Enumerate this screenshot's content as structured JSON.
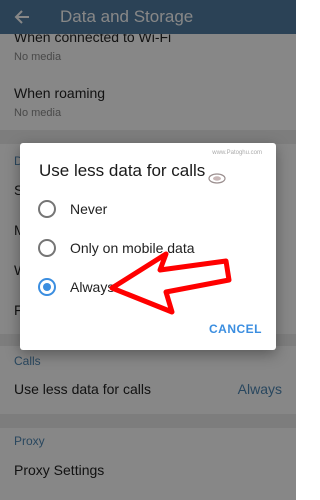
{
  "appbar": {
    "title": "Data and Storage",
    "back_icon": "arrow-left-icon"
  },
  "list": {
    "wifi": {
      "label": "When connected to Wi-Fi",
      "value": "No media"
    },
    "roaming": {
      "label": "When roaming",
      "value": "No media"
    },
    "section_d": "D",
    "truncated": [
      "S",
      "M",
      "W",
      "F"
    ],
    "calls_section": "Calls",
    "calls_row": {
      "label": "Use less data for calls",
      "value": "Always"
    },
    "proxy_section": "Proxy",
    "proxy_row": {
      "label": "Proxy Settings"
    }
  },
  "dialog": {
    "title": "Use less data for calls",
    "watermark": "www.Patoghu.com",
    "options": [
      {
        "label": "Never",
        "selected": false
      },
      {
        "label": "Only on mobile data",
        "selected": false
      },
      {
        "label": "Always",
        "selected": true
      }
    ],
    "cancel_label": "CANCEL"
  },
  "colors": {
    "appbar": "#517da2",
    "accent": "#3b8ee0",
    "arrow": "#ff0000"
  }
}
